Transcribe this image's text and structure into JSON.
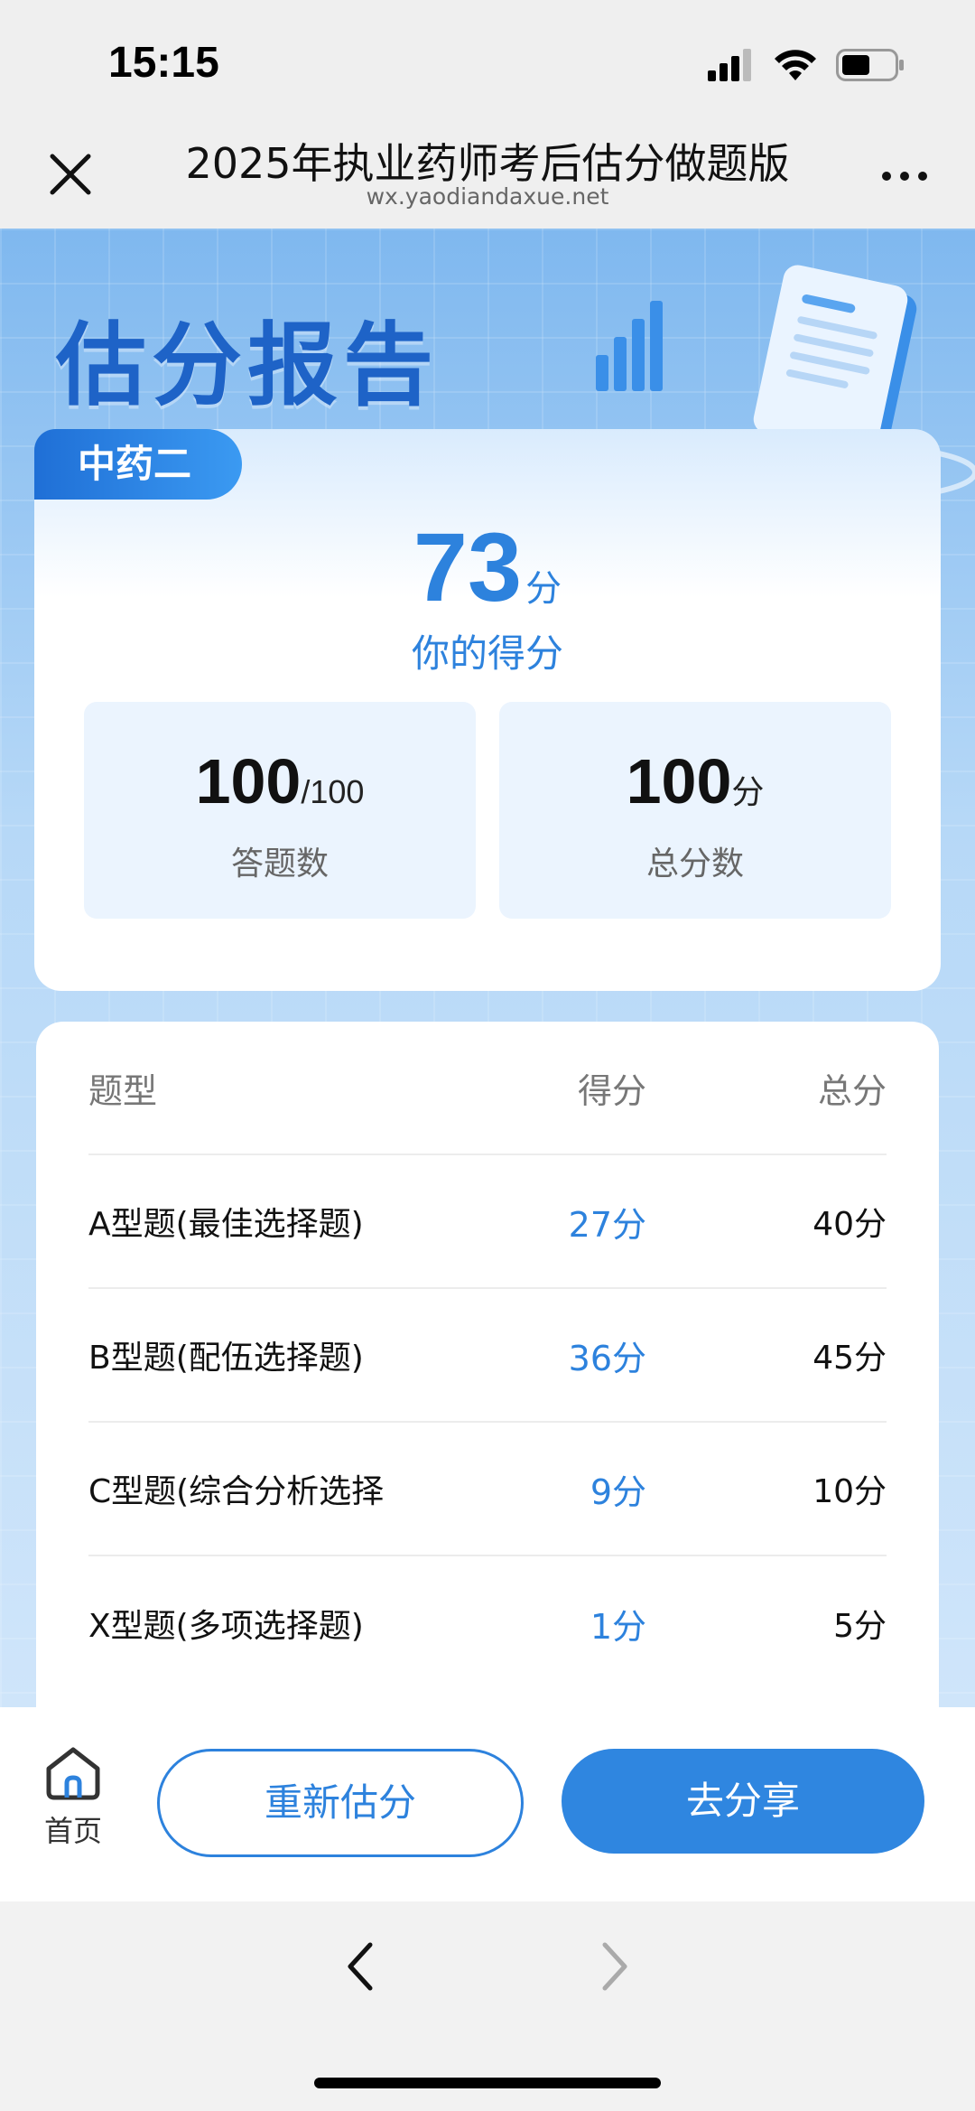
{
  "status_bar": {
    "time": "15:15"
  },
  "nav": {
    "title": "2025年执业药师考后估分做题版",
    "url": "wx.yaodiandaxue.net"
  },
  "hero": {
    "title": "估分报告"
  },
  "score_card": {
    "subject": "中药二",
    "score": "73",
    "score_unit": "分",
    "score_label": "你的得分",
    "answered": {
      "value": "100",
      "suffix": "/100",
      "label": "答题数"
    },
    "total": {
      "value": "100",
      "suffix": "分",
      "label": "总分数"
    }
  },
  "table": {
    "headers": {
      "type": "题型",
      "score": "得分",
      "total": "总分"
    },
    "rows": [
      {
        "type": "A型题(最佳选择题)",
        "score": "27分",
        "total": "40分"
      },
      {
        "type": "B型题(配伍选择题)",
        "score": "36分",
        "total": "45分"
      },
      {
        "type": "C型题(综合分析选择",
        "score": "9分",
        "total": "10分"
      },
      {
        "type": "X型题(多项选择题)",
        "score": "1分",
        "total": "5分"
      }
    ]
  },
  "actions": {
    "home_label": "首页",
    "restart_label": "重新估分",
    "share_label": "去分享"
  },
  "colors": {
    "accent": "#2d82dd",
    "brand_dark": "#1e63c7"
  }
}
